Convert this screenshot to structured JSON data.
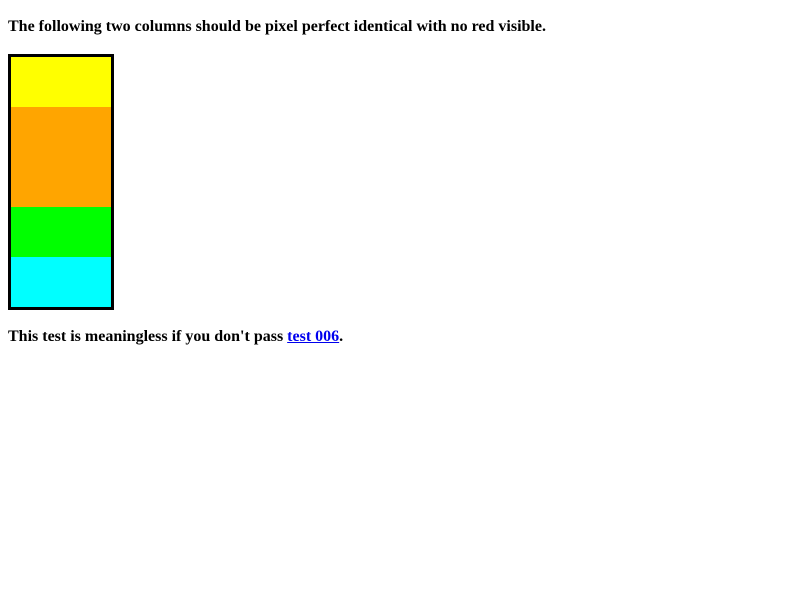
{
  "heading": {
    "text": "The following two columns should be pixel perfect identical with no red visible."
  },
  "columns": {
    "bands": [
      {
        "name": "yellow",
        "color": "#ffff00"
      },
      {
        "name": "orange",
        "color": "#ffa500"
      },
      {
        "name": "lime",
        "color": "#00ff00"
      },
      {
        "name": "cyan",
        "color": "#00ffff"
      }
    ],
    "border_color": "#000000"
  },
  "footer": {
    "prefix": "This test is meaningless if you don't pass ",
    "link_text": "test 006",
    "suffix": "."
  }
}
